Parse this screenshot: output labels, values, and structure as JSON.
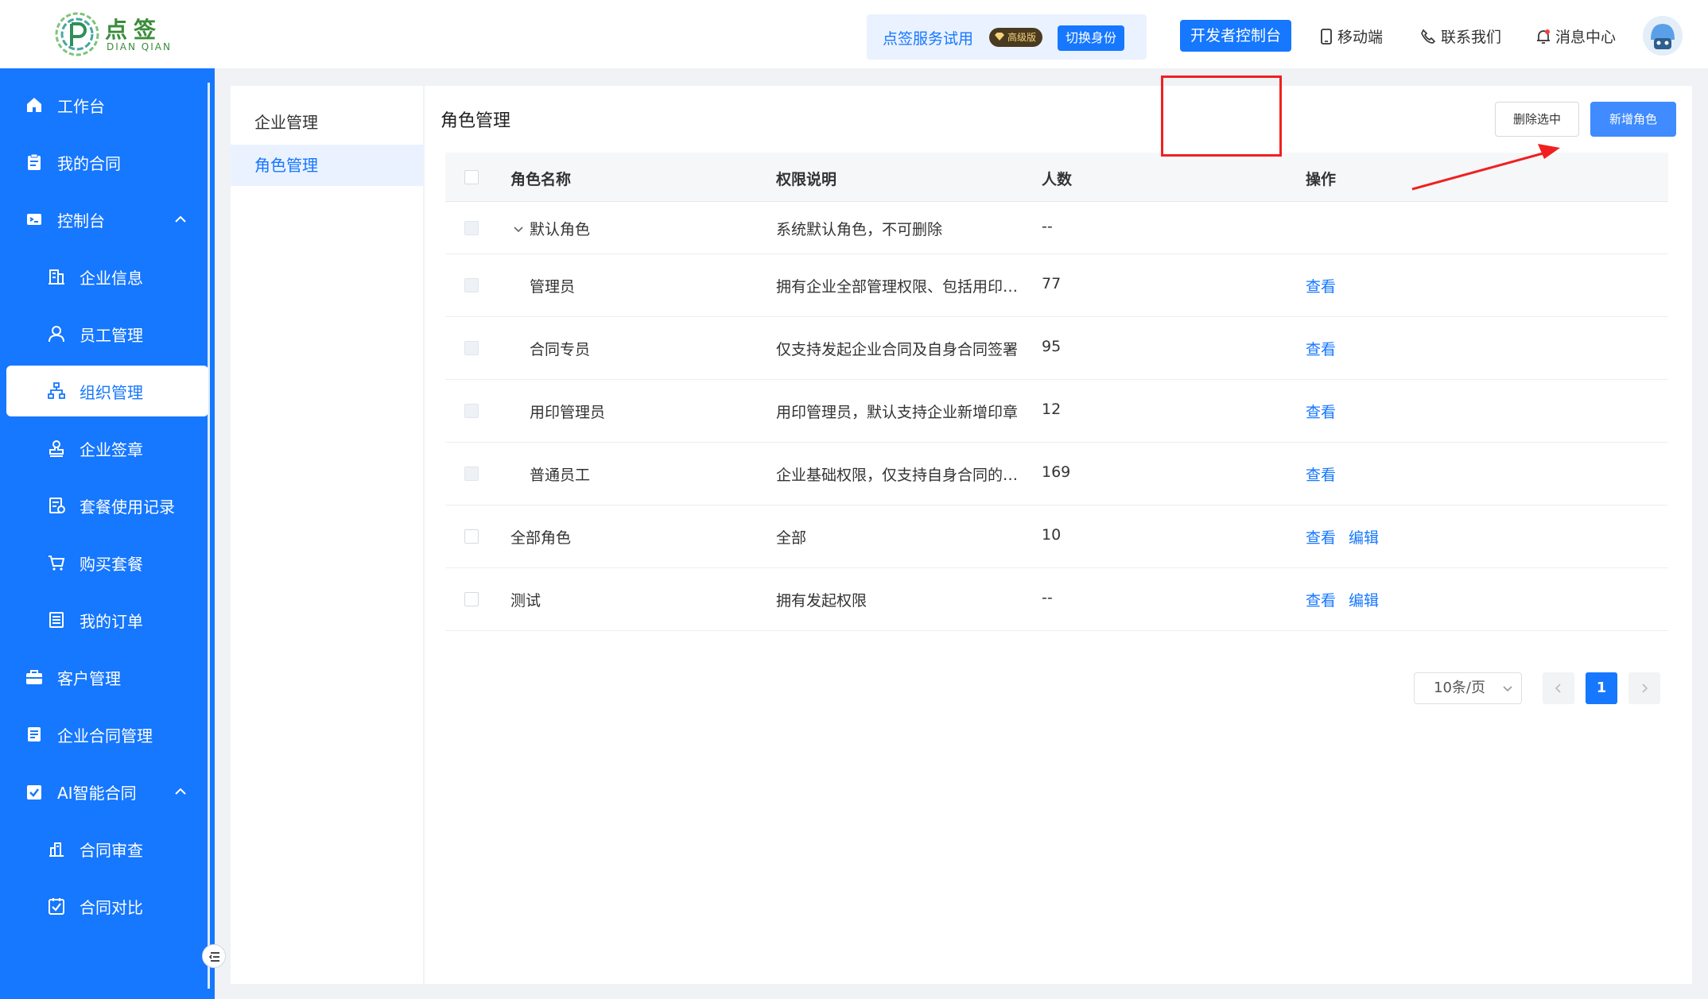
{
  "brand": {
    "name_cn": "点签",
    "name_en": "DIAN QIAN",
    "brand_color": "#3a8c3a"
  },
  "header": {
    "trial_label": "点签服务试用",
    "badge_label": "高级版",
    "switch_label": "切换身份",
    "dev_console_label": "开发者控制台",
    "links": [
      {
        "label": "移动端",
        "icon": "mobile-icon"
      },
      {
        "label": "联系我们",
        "icon": "phone-icon"
      },
      {
        "label": "消息中心",
        "icon": "bell-icon"
      }
    ]
  },
  "sidebar": {
    "items": [
      {
        "label": "工作台",
        "icon": "home-icon",
        "level": "top"
      },
      {
        "label": "我的合同",
        "icon": "clipboard-icon",
        "level": "top"
      },
      {
        "label": "控制台",
        "icon": "console-icon",
        "level": "top",
        "expanded": true
      },
      {
        "label": "企业信息",
        "icon": "building-icon",
        "level": "sub"
      },
      {
        "label": "员工管理",
        "icon": "user-icon",
        "level": "sub"
      },
      {
        "label": "组织管理",
        "icon": "org-icon",
        "level": "sub",
        "active": true
      },
      {
        "label": "企业签章",
        "icon": "seal-icon",
        "level": "sub"
      },
      {
        "label": "套餐使用记录",
        "icon": "record-icon",
        "level": "sub"
      },
      {
        "label": "购买套餐",
        "icon": "cart-icon",
        "level": "sub"
      },
      {
        "label": "我的订单",
        "icon": "order-icon",
        "level": "sub"
      },
      {
        "label": "客户管理",
        "icon": "briefcase-icon",
        "level": "top"
      },
      {
        "label": "企业合同管理",
        "icon": "contract-icon",
        "level": "top"
      },
      {
        "label": "AI智能合同",
        "icon": "ai-check-icon",
        "level": "top",
        "expanded": true
      },
      {
        "label": "合同审查",
        "icon": "review-icon",
        "level": "sub"
      },
      {
        "label": "合同对比",
        "icon": "compare-icon",
        "level": "sub"
      }
    ]
  },
  "left_menu": {
    "items": [
      "企业管理",
      "角色管理"
    ],
    "active_index": 1
  },
  "main": {
    "title": "角色管理",
    "delete_label": "删除选中",
    "add_label": "新增角色",
    "columns": [
      "角色名称",
      "权限说明",
      "人数",
      "操作"
    ],
    "rows": [
      {
        "name": "默认角色",
        "desc": "系统默认角色，不可删除",
        "count": "--",
        "group": true,
        "ops": []
      },
      {
        "name": "管理员",
        "desc": "拥有企业全部管理权限、包括用印管理、合同管理",
        "count": "77",
        "child": true,
        "ops": [
          "查看"
        ]
      },
      {
        "name": "合同专员",
        "desc": "仅支持发起企业合同及自身合同签署",
        "count": "95",
        "child": true,
        "ops": [
          "查看"
        ]
      },
      {
        "name": "用印管理员",
        "desc": "用印管理员，默认支持企业新增印章",
        "count": "12",
        "child": true,
        "ops": [
          "查看"
        ]
      },
      {
        "name": "普通员工",
        "desc": "企业基础权限，仅支持自身合同的签署",
        "count": "169",
        "child": true,
        "ops": [
          "查看"
        ]
      },
      {
        "name": "全部角色",
        "desc": "全部",
        "count": "10",
        "ops": [
          "查看",
          "编辑"
        ]
      },
      {
        "name": "测试",
        "desc": "拥有发起权限",
        "count": "--",
        "ops": [
          "查看",
          "编辑"
        ]
      }
    ],
    "pager": {
      "page_size_label": "10条/页",
      "current_page": "1"
    }
  },
  "colors": {
    "primary": "#1677ff",
    "annotation": "#f02020"
  }
}
